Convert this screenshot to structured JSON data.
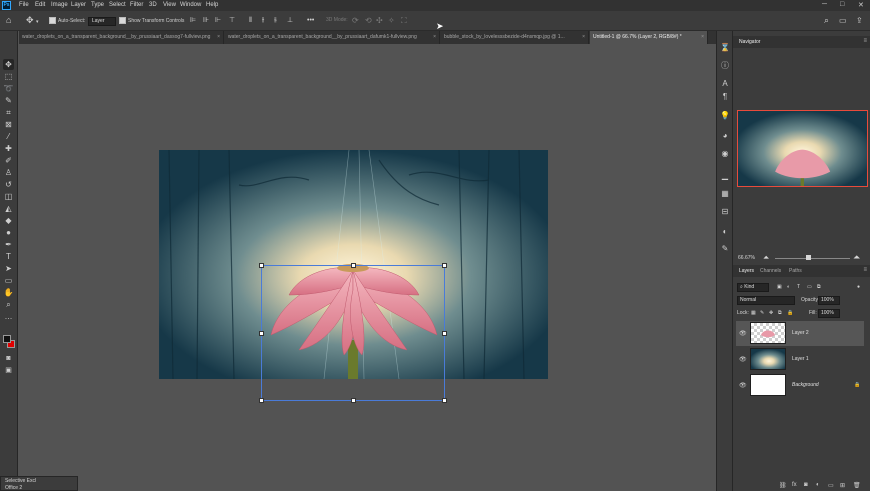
{
  "app": {
    "logo_text": "Ps",
    "icon": "photoshop-logo-icon"
  },
  "menu": [
    "File",
    "Edit",
    "Image",
    "Layer",
    "Type",
    "Select",
    "Filter",
    "3D",
    "View",
    "Window",
    "Help"
  ],
  "window_controls": {
    "minimize": "─",
    "maximize": "□",
    "close": "✕"
  },
  "options_bar": {
    "auto_select_label": "Auto-Select:",
    "auto_select_checked": true,
    "auto_select_target": "Layer",
    "show_transform_controls_label": "Show Transform Controls",
    "show_transform_controls_checked": true,
    "mode_3d_label": "3D Mode:",
    "more_label": "•••"
  },
  "tabs": [
    {
      "label": "water_droplets_on_a_transparent_background__by_prussiaart_dassog7-fullview.png",
      "active": false
    },
    {
      "label": "water_droplets_on_a_transparent_background__by_prussiaart_dafumk1-fullview.png",
      "active": false
    },
    {
      "label": "bubble_stock_by_lovelesssbezide-d4nsmqp.jpg @ 1...",
      "active": false
    },
    {
      "label": "Untitled-1 @ 66.7% (Layer 2, RGB/8#) *",
      "active": true
    }
  ],
  "tab_close": "×",
  "tools": [
    {
      "icon": "move-tool-icon",
      "glyph": "✥",
      "active": true
    },
    {
      "icon": "marquee-tool-icon",
      "glyph": "⬚",
      "active": false
    },
    {
      "icon": "lasso-tool-icon",
      "glyph": "➰",
      "active": false
    },
    {
      "icon": "quick-select-tool-icon",
      "glyph": "✎",
      "active": false
    },
    {
      "icon": "crop-tool-icon",
      "glyph": "⌗",
      "active": false
    },
    {
      "icon": "frame-tool-icon",
      "glyph": "⊠",
      "active": false
    },
    {
      "icon": "eyedropper-tool-icon",
      "glyph": "⁄",
      "active": false
    },
    {
      "icon": "healing-brush-tool-icon",
      "glyph": "✚",
      "active": false
    },
    {
      "icon": "brush-tool-icon",
      "glyph": "✐",
      "active": false
    },
    {
      "icon": "clone-stamp-tool-icon",
      "glyph": "♙",
      "active": false
    },
    {
      "icon": "history-brush-tool-icon",
      "glyph": "↺",
      "active": false
    },
    {
      "icon": "eraser-tool-icon",
      "glyph": "◫",
      "active": false
    },
    {
      "icon": "paint-bucket-tool-icon",
      "glyph": "◭",
      "active": false
    },
    {
      "icon": "blur-tool-icon",
      "glyph": "◆",
      "active": false
    },
    {
      "icon": "dodge-tool-icon",
      "glyph": "●",
      "active": false
    },
    {
      "icon": "pen-tool-icon",
      "glyph": "✒",
      "active": false
    },
    {
      "icon": "type-tool-icon",
      "glyph": "T",
      "active": false
    },
    {
      "icon": "path-selection-tool-icon",
      "glyph": "➤",
      "active": false
    },
    {
      "icon": "shape-tool-icon",
      "glyph": "▭",
      "active": false
    },
    {
      "icon": "hand-tool-icon",
      "glyph": "✋",
      "active": false
    },
    {
      "icon": "zoom-tool-icon",
      "glyph": "⌕",
      "active": false
    },
    {
      "icon": "more-tools-icon",
      "glyph": "…",
      "active": false
    }
  ],
  "colors": {
    "foreground": "#111111",
    "background": "#e00000",
    "selection": "#4a7bd8",
    "navigator_view": "#e84b3c",
    "panel_bg": "#3c3c3c"
  },
  "bottom_panel": {
    "title": "Selective Excl",
    "item": "Office 2"
  },
  "navigator": {
    "title": "Navigator",
    "zoom": "66.67%"
  },
  "layers_panel": {
    "tabs": [
      "Layers",
      "Channels",
      "Paths"
    ],
    "active_tab": "Layers",
    "kind_label": "Kind",
    "blend_mode": "Normal",
    "opacity_label": "Opacity:",
    "opacity_value": "100%",
    "lock_label": "Lock:",
    "fill_label": "Fill:",
    "fill_value": "100%",
    "layers": [
      {
        "name": "Layer 2",
        "selected": true,
        "locked": false,
        "thumb": "flower"
      },
      {
        "name": "Layer 1",
        "selected": false,
        "locked": false,
        "thumb": "forest"
      },
      {
        "name": "Background",
        "selected": false,
        "locked": true,
        "thumb": "white"
      }
    ]
  }
}
